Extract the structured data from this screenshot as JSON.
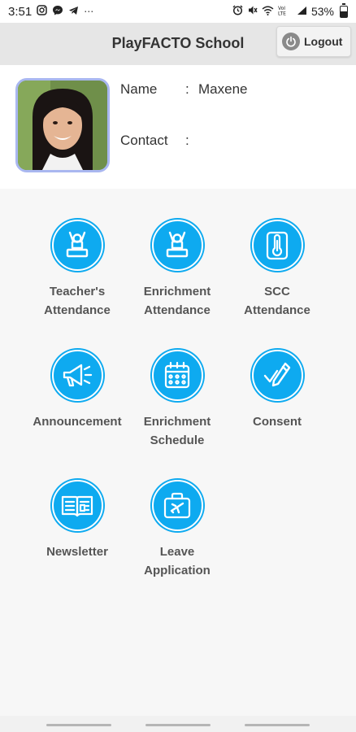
{
  "status_bar": {
    "time": "3:51",
    "left_icons": [
      "instagram-icon",
      "messenger-icon",
      "telegram-icon",
      "more-dots-icon"
    ],
    "right_icons": [
      "alarm-icon",
      "mute-icon",
      "wifi-icon",
      "volte-icon",
      "signal-icon"
    ],
    "battery": "53%",
    "battery_level": 0.53
  },
  "header": {
    "title": "PlayFACTO School",
    "logout_label": "Logout"
  },
  "profile": {
    "name_label": "Name",
    "name_value": "Maxene",
    "contact_label": "Contact",
    "contact_value": "",
    "colon": ":"
  },
  "menu": [
    {
      "label": "Teacher's\nAttendance",
      "icon": "teacher-attendance-icon"
    },
    {
      "label": "Enrichment\nAttendance",
      "icon": "enrichment-attendance-icon"
    },
    {
      "label": "SCC\nAttendance",
      "icon": "thermometer-icon"
    },
    {
      "label": "Announcement",
      "icon": "megaphone-icon"
    },
    {
      "label": "Enrichment\nSchedule",
      "icon": "calendar-icon"
    },
    {
      "label": "Consent",
      "icon": "consent-pen-icon"
    },
    {
      "label": "Newsletter",
      "icon": "newsletter-icon"
    },
    {
      "label": "Leave\nApplication",
      "icon": "suitcase-plane-icon"
    }
  ],
  "colors": {
    "accent": "#0eaaf0",
    "header_bg": "#e6e6e6",
    "avatar_border": "#a9b7f0"
  }
}
